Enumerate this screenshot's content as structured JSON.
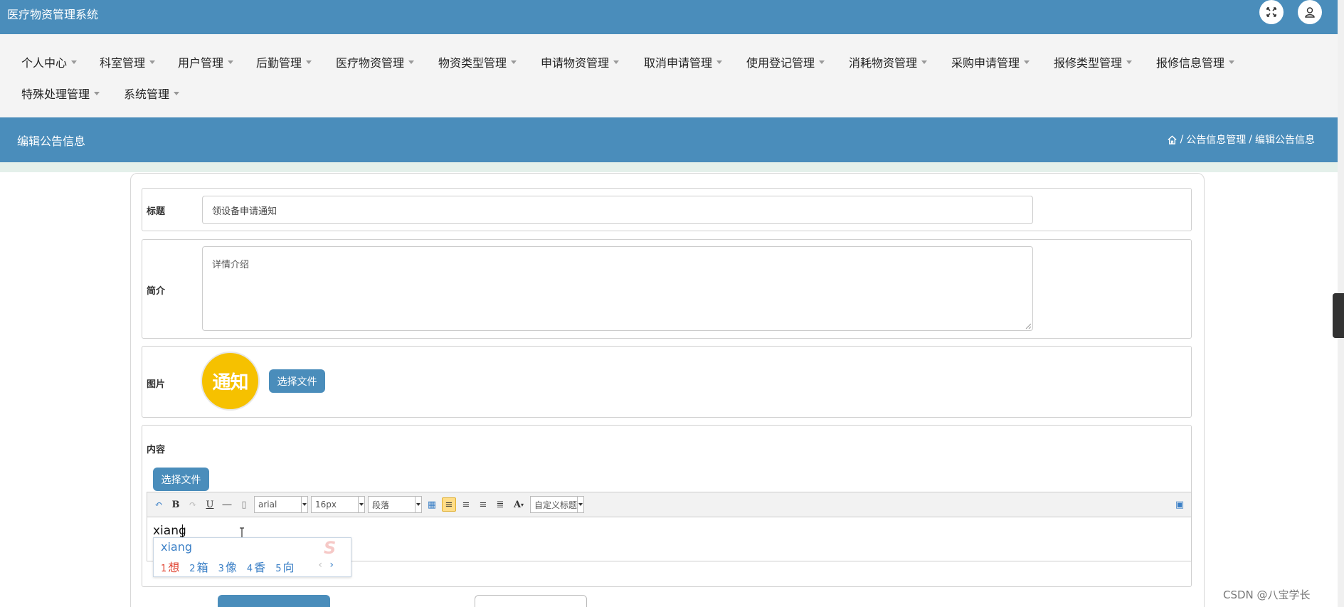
{
  "app": {
    "title": "医疗物资管理系统"
  },
  "topbar": {
    "fullscreen_icon": "expand-icon",
    "user_icon": "user-icon"
  },
  "nav": {
    "items": [
      {
        "label": "个人中心"
      },
      {
        "label": "科室管理"
      },
      {
        "label": "用户管理"
      },
      {
        "label": "后勤管理"
      },
      {
        "label": "医疗物资管理"
      },
      {
        "label": "物资类型管理"
      },
      {
        "label": "申请物资管理"
      },
      {
        "label": "取消申请管理"
      },
      {
        "label": "使用登记管理"
      },
      {
        "label": "消耗物资管理"
      },
      {
        "label": "采购申请管理"
      },
      {
        "label": "报修类型管理"
      },
      {
        "label": "报修信息管理"
      },
      {
        "label": "特殊处理管理"
      },
      {
        "label": "系统管理"
      }
    ]
  },
  "header": {
    "page_title": "编辑公告信息",
    "breadcrumb": {
      "sep": "/",
      "item1": "公告信息管理",
      "item2": "编辑公告信息"
    }
  },
  "form": {
    "title": {
      "label": "标题",
      "value": "领设备申请通知"
    },
    "intro": {
      "label": "简介",
      "value": "详情介绍"
    },
    "image": {
      "label": "图片",
      "image_text": "通知",
      "button": "选择文件"
    },
    "content": {
      "label": "内容",
      "button": "选择文件",
      "toolbar": {
        "font": "arial",
        "size": "16px",
        "paragraph": "段落",
        "custom_title": "自定义标题",
        "bold": "B",
        "underline": "U",
        "font_color": "A"
      },
      "editor_text": "xiang"
    }
  },
  "ime": {
    "input": "xiang",
    "candidates": [
      {
        "num": "1",
        "text": "想"
      },
      {
        "num": "2",
        "text": "箱"
      },
      {
        "num": "3",
        "text": "像"
      },
      {
        "num": "4",
        "text": "香"
      },
      {
        "num": "5",
        "text": "向"
      }
    ],
    "prev": "‹",
    "next": "›"
  },
  "watermark": "CSDN @八宝学长",
  "colors": {
    "primary": "#4a8dbb",
    "nav_bg": "#f4f4f4",
    "notice": "#f6c100",
    "ime_text": "#3a7fc6",
    "ime_first": "#e0402e"
  }
}
